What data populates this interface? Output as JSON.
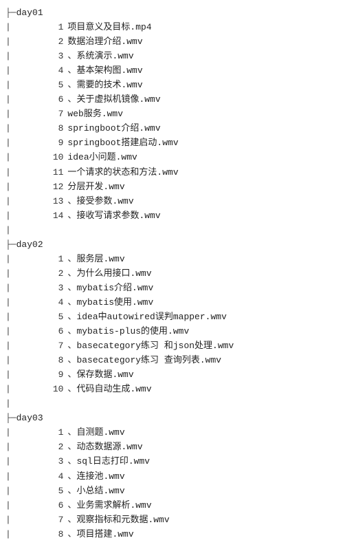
{
  "tree": [
    {
      "folder": "day01",
      "items": [
        {
          "idx": "1",
          "sep": " ",
          "name": "项目意义及目标.mp4"
        },
        {
          "idx": "2",
          "sep": " ",
          "name": "数据治理介绍.wmv"
        },
        {
          "idx": "3",
          "sep": "、",
          "name": "系统演示.wmv"
        },
        {
          "idx": "4",
          "sep": "、",
          "name": "基本架构图.wmv"
        },
        {
          "idx": "5",
          "sep": "、",
          "name": "需要的技术.wmv"
        },
        {
          "idx": "6",
          "sep": "、",
          "name": "关于虚拟机镜像.wmv"
        },
        {
          "idx": "7",
          "sep": " ",
          "name": "web服务.wmv"
        },
        {
          "idx": "8",
          "sep": " ",
          "name": "springboot介绍.wmv"
        },
        {
          "idx": "9",
          "sep": " ",
          "name": "springboot搭建启动.wmv"
        },
        {
          "idx": "10",
          "sep": " ",
          "name": "idea小问题.wmv"
        },
        {
          "idx": "11",
          "sep": " ",
          "name": "一个请求的状态和方法.wmv"
        },
        {
          "idx": "12",
          "sep": " ",
          "name": "分层开发.wmv"
        },
        {
          "idx": "13",
          "sep": "、",
          "name": "接受参数.wmv"
        },
        {
          "idx": "14",
          "sep": "、",
          "name": "接收写请求参数.wmv"
        }
      ]
    },
    {
      "folder": "day02",
      "items": [
        {
          "idx": "1",
          "sep": "、",
          "name": "服务层.wmv"
        },
        {
          "idx": "2",
          "sep": "、",
          "name": "为什么用接口.wmv"
        },
        {
          "idx": "3",
          "sep": "、",
          "name": "mybatis介绍.wmv"
        },
        {
          "idx": "4",
          "sep": "、",
          "name": "mybatis使用.wmv"
        },
        {
          "idx": "5",
          "sep": "、",
          "name": "idea中autowired误判mapper.wmv"
        },
        {
          "idx": "6",
          "sep": "、",
          "name": "mybatis-plus的使用.wmv"
        },
        {
          "idx": "7",
          "sep": "、",
          "name": "basecategory练习  和json处理.wmv"
        },
        {
          "idx": "8",
          "sep": "、",
          "name": "basecategory练习 查询列表.wmv"
        },
        {
          "idx": "9",
          "sep": "、",
          "name": "保存数据.wmv"
        },
        {
          "idx": "10",
          "sep": "、",
          "name": "代码自动生成.wmv"
        }
      ]
    },
    {
      "folder": "day03",
      "items": [
        {
          "idx": "1",
          "sep": "、",
          "name": "自测题.wmv"
        },
        {
          "idx": "2",
          "sep": "、",
          "name": "动态数据源.wmv"
        },
        {
          "idx": "3",
          "sep": "、",
          "name": "sql日志打印.wmv"
        },
        {
          "idx": "4",
          "sep": "、",
          "name": "连接池.wmv"
        },
        {
          "idx": "5",
          "sep": "、",
          "name": "小总结.wmv"
        },
        {
          "idx": "6",
          "sep": "、",
          "name": "业务需求解析.wmv"
        },
        {
          "idx": "7",
          "sep": "、",
          "name": "观察指标和元数据.wmv"
        },
        {
          "idx": "8",
          "sep": "、",
          "name": "项目搭建.wmv"
        }
      ]
    }
  ],
  "glyphs": {
    "branch": "├─",
    "pipe": "|       "
  }
}
